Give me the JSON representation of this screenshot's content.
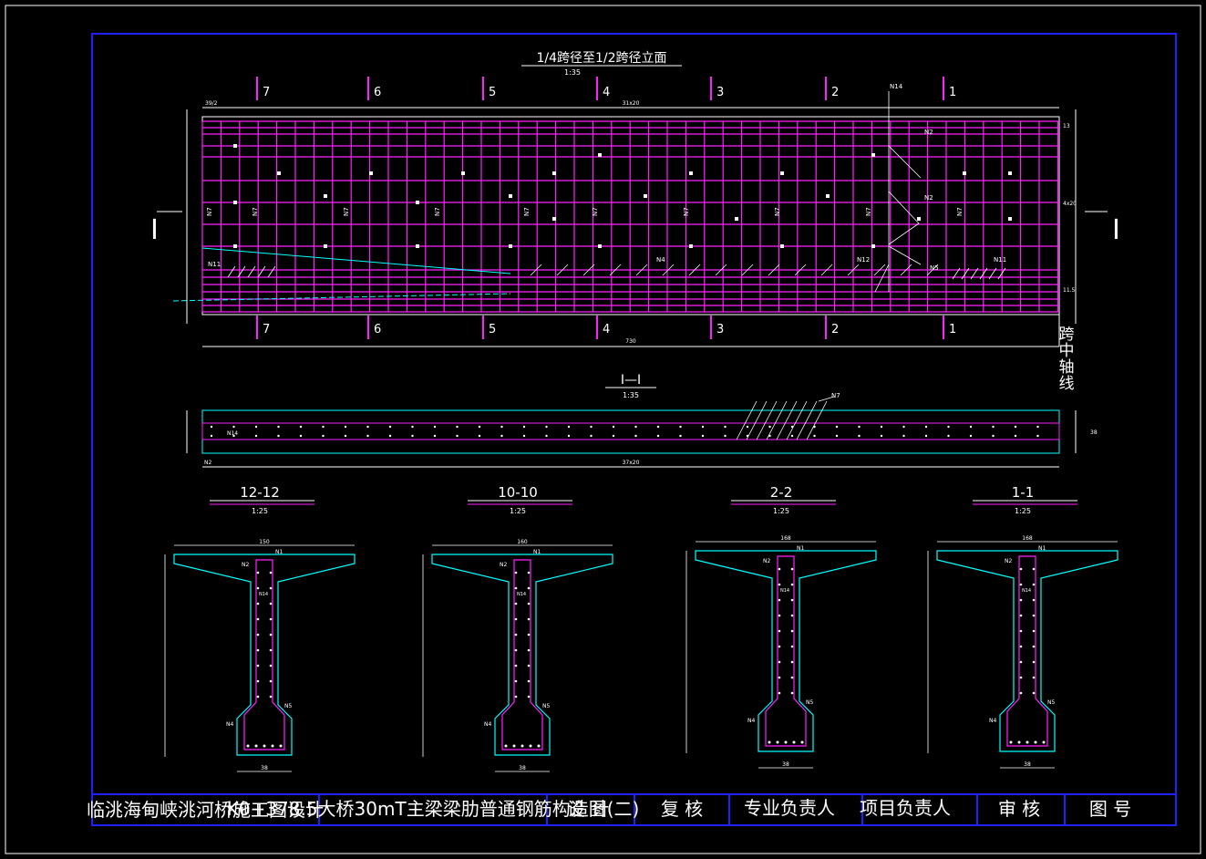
{
  "elevation": {
    "title": "1/4跨径至1/2跨径立面",
    "scale": "1:35",
    "section_numbers": [
      "7",
      "6",
      "5",
      "4",
      "3",
      "2",
      "1"
    ],
    "section_marker_left": "I",
    "section_marker_right": "I",
    "centerline_label": "跨中轴线",
    "bar_labels": {
      "n7": "N7",
      "n14": "N14",
      "n2": "N2",
      "n4": "N4",
      "n11": "N11",
      "n12": "N12",
      "n5": "N5"
    },
    "dims": {
      "top_left": "39/2",
      "top_span": "31x20",
      "bottom_span": "730",
      "right_top": "13",
      "right_mid": "4x20",
      "right_bot": "11.5"
    }
  },
  "plan": {
    "title": "I—I",
    "scale": "1:35",
    "label_n7": "N7",
    "label_n14": "N14",
    "bottom_dim": "37x20",
    "left_dim": "N2",
    "right_dim": "38"
  },
  "sections": [
    {
      "title": "12-12",
      "scale": "1:25",
      "top_dim": "150",
      "bot_dim": "38"
    },
    {
      "title": "10-10",
      "scale": "1:25",
      "top_dim": "160",
      "bot_dim": "38"
    },
    {
      "title": "2-2",
      "scale": "1:25",
      "top_dim": "168",
      "bot_dim": "38"
    },
    {
      "title": "1-1",
      "scale": "1:25",
      "top_dim": "168",
      "bot_dim": "38"
    }
  ],
  "section_labels": {
    "n1": "N1",
    "n2": "N2",
    "n14": "N14",
    "n4": "N4",
    "n5": "N5",
    "n3": "N3"
  },
  "title_block": {
    "project": "临洮海甸峡洮河桥施工图设计",
    "drawing": "K0+378.5大桥30mT主梁梁肋普通钢筋构造图(二)",
    "design": "设 计",
    "review": "复 核",
    "specialist": "专业负责人",
    "project_lead": "项目负责人",
    "approve": "审 核",
    "drawing_no": "图 号"
  },
  "colors": {
    "frame": "#2020ff",
    "rebar": "#ff20ff",
    "concrete": "#00ffff",
    "line": "#ffffff"
  }
}
